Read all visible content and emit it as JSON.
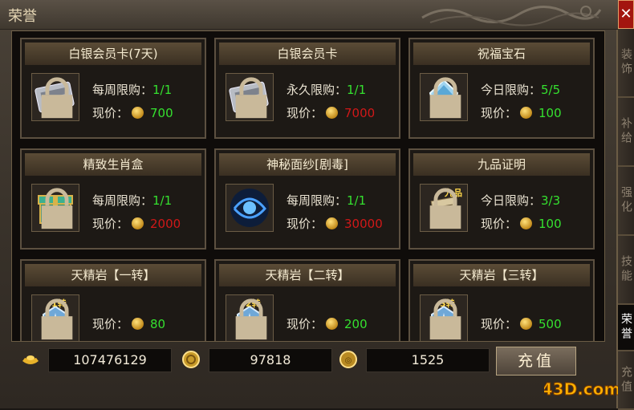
{
  "window": {
    "title": "荣誉",
    "close_label": "✕"
  },
  "side_tabs": [
    {
      "label": "装饰"
    },
    {
      "label": "补给"
    },
    {
      "label": "强化"
    },
    {
      "label": "技能"
    },
    {
      "label": "荣誉"
    },
    {
      "label": "充值"
    }
  ],
  "items": [
    {
      "name": "白银会员卡(7天)",
      "icon": "silver-card-icon",
      "limit_label": "每周限购：",
      "limit": "1/1",
      "price_label": "现价：",
      "price": "700",
      "price_color": "green"
    },
    {
      "name": "白银会员卡",
      "icon": "silver-card-icon",
      "limit_label": "永久限购：",
      "limit": "1/1",
      "price_label": "现价：",
      "price": "7000",
      "price_color": "red"
    },
    {
      "name": "祝福宝石",
      "icon": "blessing-gem-icon",
      "limit_label": "今日限购：",
      "limit": "5/5",
      "price_label": "现价：",
      "price": "100",
      "price_color": "green"
    },
    {
      "name": "精致生肖盒",
      "icon": "zodiac-box-icon",
      "limit_label": "每周限购：",
      "limit": "1/1",
      "price_label": "现价：",
      "price": "2000",
      "price_color": "red"
    },
    {
      "name": "神秘面纱[剧毒]",
      "icon": "mystic-veil-icon",
      "limit_label": "每周限购：",
      "limit": "1/1",
      "price_label": "现价：",
      "price": "30000",
      "price_color": "red"
    },
    {
      "name": "九品证明",
      "icon": "scroll-icon",
      "icon_text": "九品",
      "limit_label": "今日限购：",
      "limit": "3/3",
      "price_label": "现价：",
      "price": "100",
      "price_color": "green"
    },
    {
      "name": "天精岩【一转】",
      "icon": "sky-stone-icon",
      "icon_text": "1转",
      "price_label": "现价：",
      "price": "80",
      "price_color": "green"
    },
    {
      "name": "天精岩【二转】",
      "icon": "sky-stone-icon",
      "icon_text": "2转",
      "price_label": "现价：",
      "price": "200",
      "price_color": "green"
    },
    {
      "name": "天精岩【三转】",
      "icon": "sky-stone-icon",
      "icon_text": "3转",
      "price_label": "现价：",
      "price": "500",
      "price_color": "green"
    }
  ],
  "currency": {
    "gold_ingot": "107476129",
    "gold_coin": "97818",
    "honor_coin": "1525",
    "recharge_label": "充值"
  },
  "logo": {
    "text": "43D.com"
  },
  "colors": {
    "green": "#35e02f",
    "red": "#d01818",
    "accent": "#6b5c45",
    "close": "#a3160f"
  }
}
